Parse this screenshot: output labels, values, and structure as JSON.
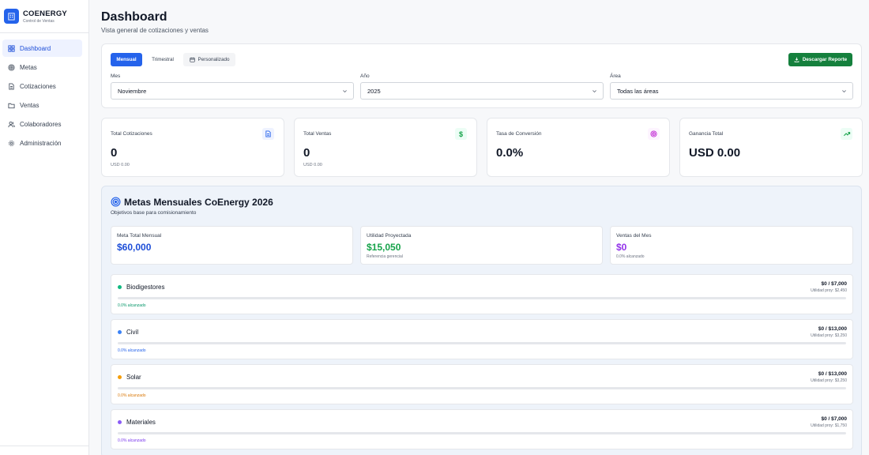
{
  "brand": {
    "name": "COENERGY",
    "tagline": "Control de Ventas",
    "logo_icon": "building-icon"
  },
  "sidebar": {
    "items": [
      {
        "label": "Dashboard",
        "icon": "grid-icon",
        "active": true
      },
      {
        "label": "Metas",
        "icon": "target-icon"
      },
      {
        "label": "Cotizaciones",
        "icon": "document-icon"
      },
      {
        "label": "Ventas",
        "icon": "folder-icon"
      },
      {
        "label": "Colaboradores",
        "icon": "users-icon"
      },
      {
        "label": "Administración",
        "icon": "gear-icon"
      }
    ]
  },
  "header": {
    "title": "Dashboard",
    "subtitle": "Vista general de cotizaciones y ventas"
  },
  "filters": {
    "tabs": [
      {
        "label": "Mensual",
        "active": true
      },
      {
        "label": "Trimestral"
      },
      {
        "label": "Personalizado",
        "icon": "calendar-icon"
      }
    ],
    "download_label": "Descargar Reporte",
    "mes": {
      "label": "Mes",
      "value": "Noviembre"
    },
    "anio": {
      "label": "Año",
      "value": "2025"
    },
    "area": {
      "label": "Área",
      "value": "Todas las áreas"
    }
  },
  "stats": [
    {
      "label": "Total Cotizaciones",
      "value": "0",
      "sub": "USD 0.00",
      "icon": "document-icon",
      "color": "#2563eb",
      "bg": "#eef2ff"
    },
    {
      "label": "Total Ventas",
      "value": "0",
      "sub": "USD 0.00",
      "icon": "dollar-icon",
      "color": "#16a34a",
      "bg": "#ecfdf5"
    },
    {
      "label": "Tasa de Conversión",
      "value": "0.0%",
      "sub": "",
      "icon": "target-icon",
      "color": "#c026d3",
      "bg": "#fdf4ff"
    },
    {
      "label": "Ganancia Total",
      "value": "USD 0.00",
      "sub": "",
      "icon": "trending-up-icon",
      "color": "#16a34a",
      "bg": "#ecfdf5"
    }
  ],
  "metas": {
    "title": "Metas Mensuales CoEnergy 2026",
    "subtitle": "Objetivos base para comisionamiento",
    "cards": [
      {
        "label": "Meta Total Mensual",
        "value": "$60,000",
        "sub": "",
        "color": "#1d4ed8"
      },
      {
        "label": "Utilidad Proyectada",
        "value": "$15,050",
        "sub": "Referencia gerencial",
        "color": "#16a34a"
      },
      {
        "label": "Ventas del Mes",
        "value": "$0",
        "sub": "0.0% alcanzado",
        "color": "#9333ea"
      }
    ],
    "categories": [
      {
        "name": "Biodigestores",
        "amount": "$0 / $7,000",
        "utilidad": "Utilidad proy: $2,450",
        "pct": "0.0% alcanzado",
        "progress": 0,
        "color": "#10b981"
      },
      {
        "name": "Civil",
        "amount": "$0 / $13,000",
        "utilidad": "Utilidad proy: $3,250",
        "pct": "0.0% alcanzado",
        "progress": 0,
        "color": "#3b82f6"
      },
      {
        "name": "Solar",
        "amount": "$0 / $13,000",
        "utilidad": "Utilidad proy: $3,250",
        "pct": "0.0% alcanzado",
        "progress": 0,
        "color": "#f59e0b"
      },
      {
        "name": "Materiales",
        "amount": "$0 / $7,000",
        "utilidad": "Utilidad proy: $1,750",
        "pct": "0.0% alcanzado",
        "progress": 0,
        "color": "#8b5cf6"
      }
    ]
  }
}
